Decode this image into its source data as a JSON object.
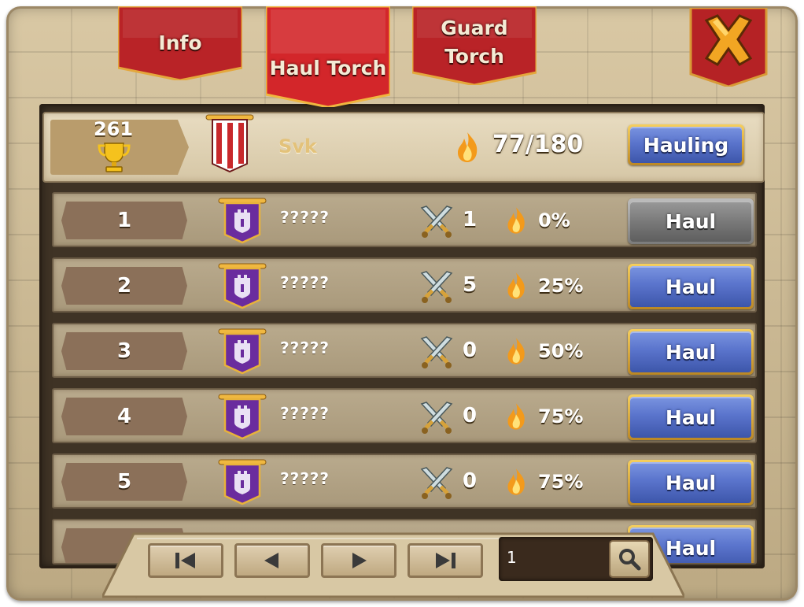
{
  "tabs": [
    {
      "label_lines": [
        "Info"
      ],
      "active": false
    },
    {
      "label_lines": [
        "Haul Torch"
      ],
      "active": true
    },
    {
      "label_lines": [
        "Guard",
        "Torch"
      ],
      "active": false
    }
  ],
  "header": {
    "score": "261",
    "guild_name": "Svk",
    "torch_count": "77/180",
    "button_label": "Hauling"
  },
  "rows": [
    {
      "rank": "1",
      "name": "?????",
      "defenders": "1",
      "percent": "0%",
      "button_label": "Haul",
      "button_enabled": false
    },
    {
      "rank": "2",
      "name": "?????",
      "defenders": "5",
      "percent": "25%",
      "button_label": "Haul",
      "button_enabled": true
    },
    {
      "rank": "3",
      "name": "?????",
      "defenders": "0",
      "percent": "50%",
      "button_label": "Haul",
      "button_enabled": true
    },
    {
      "rank": "4",
      "name": "?????",
      "defenders": "0",
      "percent": "75%",
      "button_label": "Haul",
      "button_enabled": true
    },
    {
      "rank": "5",
      "name": "?????",
      "defenders": "0",
      "percent": "75%",
      "button_label": "Haul",
      "button_enabled": true
    }
  ],
  "partial_row": {
    "button_label": "Haul"
  },
  "pager": {
    "page_value": "1"
  },
  "icons": {
    "close": "close-x-icon",
    "trophy": "trophy-icon",
    "flame": "flame-icon",
    "swords": "crossed-swords-icon",
    "header_banner": "red-white-striped-banner",
    "guild_banner": "purple-castle-banner",
    "search": "magnifier-icon"
  },
  "colors": {
    "tab_red": "#c8262a",
    "button_blue": "#5a74cc",
    "button_gray": "#7a7a7a",
    "gold_trim": "#e7b23a",
    "stone": "#cdbb96"
  }
}
